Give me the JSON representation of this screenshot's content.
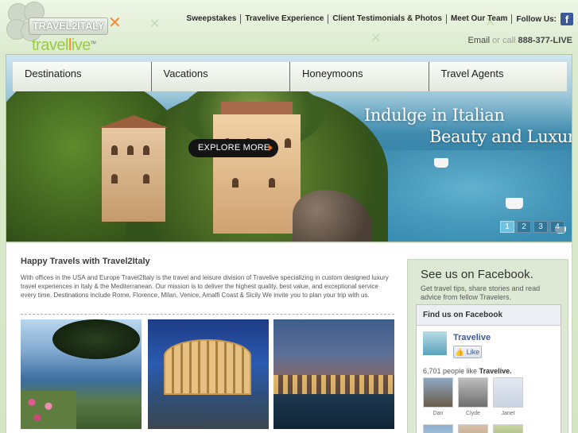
{
  "brand": {
    "badge_text": "TRAVEL2ITALY",
    "sub_logo_prefix": "travel",
    "sub_logo_suffix": "ive",
    "sub_logo_mark": "TM"
  },
  "top_nav": {
    "links": [
      "Sweepstakes",
      "Travelive Experience",
      "Client Testimonials & Photos",
      "Meet Our Team"
    ],
    "follow_label": "Follow Us:",
    "facebook_glyph": "f"
  },
  "contact": {
    "email_label": "Email",
    "or_call": "or call",
    "phone": "888-377-LIVE"
  },
  "main_nav": [
    "Destinations",
    "Vacations",
    "Honeymoons",
    "Travel Agents"
  ],
  "hero": {
    "tagline_line1": "Indulge in Italian",
    "tagline_line2": "Beauty and Luxury",
    "cta_label": "EXPLORE MORE",
    "slides": [
      "1",
      "2",
      "3",
      "4"
    ],
    "active_slide": 1
  },
  "intro": {
    "title": "Happy Travels with Travel2Italy",
    "body": "With offices in the USA and Europe Travel2Italy is the travel and leisure division of Travelive specializing in custom designed luxury travel experiences in Italy & the Mediterranean. Our mission is to deliver the highest quality, best value, and exceptional service every time. Destinations include Rome, Florence, Milan, Venice, Amalfi Coast & Sicily We invite you to plan your trip with us."
  },
  "facebook": {
    "title": "See us on Facebook.",
    "subtitle": "Get travel tips, share stories and read advice from fellow Travelers.",
    "panel_header": "Find us on Facebook",
    "page_name": "Travelive",
    "like_label": "Like",
    "count_text": "6,701 people like",
    "count_page": "Travelive.",
    "fans": [
      "Dan",
      "Clyde",
      "Janet"
    ]
  },
  "colors": {
    "accent_orange": "#f08a3c",
    "brand_green": "#9acb40",
    "facebook_blue": "#3b5998",
    "slide_active": "#6fc2e2"
  }
}
